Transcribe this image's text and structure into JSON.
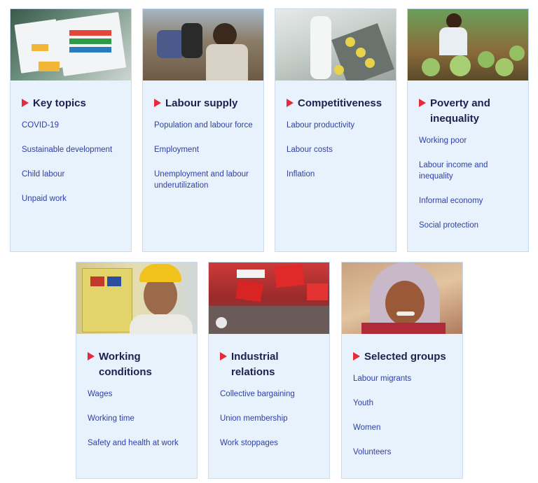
{
  "cards": [
    {
      "title_lines": [
        "Key topics"
      ],
      "image": "sustainable-development-goals-chart-photo",
      "links": [
        "COVID-19",
        "Sustainable development",
        "Child labour",
        "Unpaid work"
      ]
    },
    {
      "title_lines": [
        "Labour supply"
      ],
      "image": "workers-sitting-photo",
      "links": [
        "Population and labour force",
        "Employment",
        "Unemployment and labour underutilization"
      ]
    },
    {
      "title_lines": [
        "Competitiveness"
      ],
      "image": "factory-production-line-photo",
      "links": [
        "Labour productivity",
        "Labour costs",
        "Inflation"
      ]
    },
    {
      "title_lines": [
        "Poverty and",
        "inequality"
      ],
      "image": "woman-with-fruit-photo",
      "links": [
        "Working poor",
        "Labour income and inequality",
        "Informal economy",
        "Social protection"
      ]
    },
    {
      "title_lines": [
        "Working",
        "conditions"
      ],
      "image": "construction-worker-hard-hat-photo",
      "links": [
        "Wages",
        "Working time",
        "Safety and health at work"
      ]
    },
    {
      "title_lines": [
        "Industrial",
        "relations"
      ],
      "image": "union-demonstration-flags-photo",
      "links": [
        "Collective bargaining",
        "Union membership",
        "Work stoppages"
      ]
    },
    {
      "title_lines": [
        "Selected groups"
      ],
      "image": "smiling-woman-headscarf-photo",
      "links": [
        "Labour migrants",
        "Youth",
        "Women",
        "Volunteers"
      ]
    }
  ],
  "colors": {
    "card_background": "#e8f2fc",
    "title": "#1e2050",
    "link": "#2f3fa8",
    "arrow": "#e8283b"
  }
}
